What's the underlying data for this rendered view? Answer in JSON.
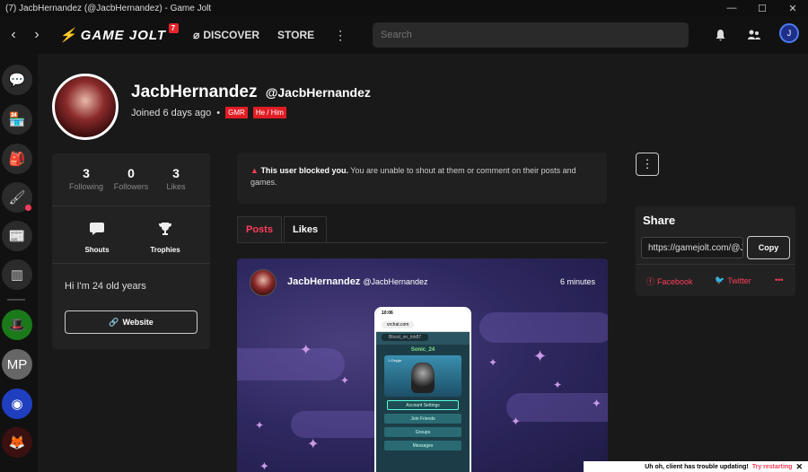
{
  "window": {
    "title": "(7) JacbHernandez (@JacbHernandez) - Game Jolt",
    "minimize": "—",
    "maximize": "☐",
    "close": "✕"
  },
  "nav": {
    "back": "‹",
    "forward": "›",
    "logo": "GAME JOLT",
    "notification_count": "7",
    "discover": "DISCOVER",
    "store": "STORE",
    "more": "⋮",
    "search_placeholder": "Search",
    "user_initial": "J"
  },
  "sidebar": {
    "mp_label": "MP"
  },
  "profile": {
    "display_name": "JacbHernandez",
    "username": "@JacbHernandez",
    "joined": "Joined 6 days ago",
    "separator": "•",
    "tags": [
      "GMR",
      "He / Him"
    ],
    "stats": [
      {
        "value": "3",
        "label": "Following"
      },
      {
        "value": "0",
        "label": "Followers"
      },
      {
        "value": "3",
        "label": "Likes"
      }
    ],
    "shouts_label": "Shouts",
    "trophies_label": "Trophies",
    "bio": "Hi I'm 24 old years",
    "website_label": "Website"
  },
  "notice": {
    "bold": "This user blocked you.",
    "text": " You are unable to shout at them or comment on their posts and games."
  },
  "tabs": [
    {
      "label": "Posts",
      "active": true
    },
    {
      "label": "Likes",
      "active": false
    }
  ],
  "post": {
    "author": "JacbHernandez",
    "handle": "@JacbHernandez",
    "time": "6 minutes",
    "phone": {
      "clock": "10:06",
      "url": "vrchat.com",
      "search": "Blood_on_Ink87",
      "name": "Sonic_24",
      "card_label": "1-Oxygn",
      "counter": "▾ 0",
      "rows": [
        "Account Settings",
        "Join Friends",
        "Groups",
        "Messages"
      ]
    }
  },
  "share": {
    "title": "Share",
    "url": "https://gamejolt.com/@JacbHernandez",
    "copy": "Copy",
    "facebook": "Facebook",
    "twitter": "Twitter",
    "more": "•••"
  },
  "toast": {
    "message": "Uh oh, client has trouble updating!",
    "action": "Try restarting",
    "close": "✕"
  },
  "colors": {
    "accent": "#ff3d5a",
    "tag": "#e01d24",
    "background": "#191919",
    "card": "#222222"
  }
}
